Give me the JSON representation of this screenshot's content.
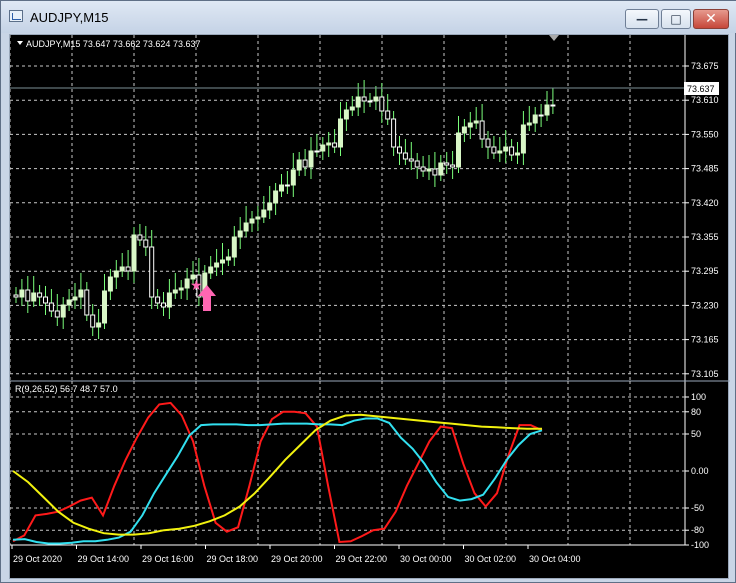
{
  "window": {
    "title": "AUDJPY,M15",
    "buttons": {
      "minimize": "—",
      "maximize": "□",
      "close": "✕"
    }
  },
  "main_chart": {
    "header": "AUDJPY,M15  73.647 73.662 73.624 73.637",
    "current_price": "73.637",
    "price_labels": [
      "73.675",
      "73.610",
      "73.550",
      "73.485",
      "73.420",
      "73.355",
      "73.295",
      "73.230",
      "73.165",
      "73.105"
    ],
    "bull_color": "#d9f7c7",
    "bear_color": "#ffffff",
    "wick_color": "#7bff7b",
    "marker": {
      "star_icon": "★",
      "arrow_icon": "up-arrow",
      "color": "#ff66b3"
    }
  },
  "indicator": {
    "header": "R(9,26,52) 56.7 48.7 57.0",
    "levels": [
      "100",
      "80",
      "50",
      "0.00",
      "-50",
      "-80",
      "-100"
    ],
    "colors": {
      "red": "#ff1a1a",
      "cyan": "#32e0f0",
      "yellow": "#f2f20f"
    }
  },
  "time_axis": {
    "labels": [
      "29 Oct 2020",
      "29 Oct 14:00",
      "29 Oct 16:00",
      "29 Oct 18:00",
      "29 Oct 20:00",
      "29 Oct 22:00",
      "30 Oct 00:00",
      "30 Oct 02:00",
      "30 Oct 04:00"
    ]
  },
  "chart_data": [
    {
      "type": "candlestick",
      "title": "AUDJPY,M15",
      "ylim": [
        73.105,
        73.675
      ],
      "yticks": [
        73.675,
        73.61,
        73.55,
        73.485,
        73.42,
        73.355,
        73.295,
        73.23,
        73.165,
        73.105
      ],
      "current_price": 73.637
    },
    {
      "type": "line",
      "title": "R(9,26,52) 56.7 48.7 57.0",
      "ylim": [
        -100,
        100
      ],
      "yticks": [
        100,
        80,
        50,
        0,
        -50,
        -80,
        -100
      ],
      "series": [
        {
          "values": [
            -95,
            -87,
            -60,
            -58,
            -55,
            -48,
            -40,
            -36,
            -60,
            -20,
            15,
            45,
            72,
            90,
            92,
            75,
            40,
            -20,
            -70,
            -82,
            -76,
            -20,
            40,
            70,
            80,
            80,
            78,
            60,
            -20,
            -96,
            -95,
            -88,
            -80,
            -78,
            -55,
            -20,
            10,
            40,
            60,
            58,
            10,
            -30,
            -48,
            -30,
            20,
            62,
            62,
            55
          ]
        },
        {
          "values": [
            -93,
            -92,
            -96,
            -98,
            -98,
            -97,
            -95,
            -95,
            -93,
            -90,
            -82,
            -60,
            -30,
            -5,
            20,
            48,
            62,
            63,
            63,
            63,
            62,
            62,
            63,
            64,
            64,
            64,
            63,
            63,
            62,
            68,
            71,
            71,
            65,
            45,
            30,
            10,
            -15,
            -35,
            -40,
            -38,
            -32,
            -10,
            15,
            35,
            50,
            55
          ]
        },
        {
          "values": [
            0,
            -15,
            -35,
            -55,
            -70,
            -78,
            -84,
            -86,
            -86,
            -84,
            -80,
            -78,
            -74,
            -68,
            -60,
            -48,
            -30,
            -8,
            15,
            35,
            55,
            68,
            75,
            76,
            74,
            72,
            70,
            68,
            66,
            64,
            62,
            60,
            59,
            58,
            57,
            57
          ]
        }
      ]
    }
  ]
}
